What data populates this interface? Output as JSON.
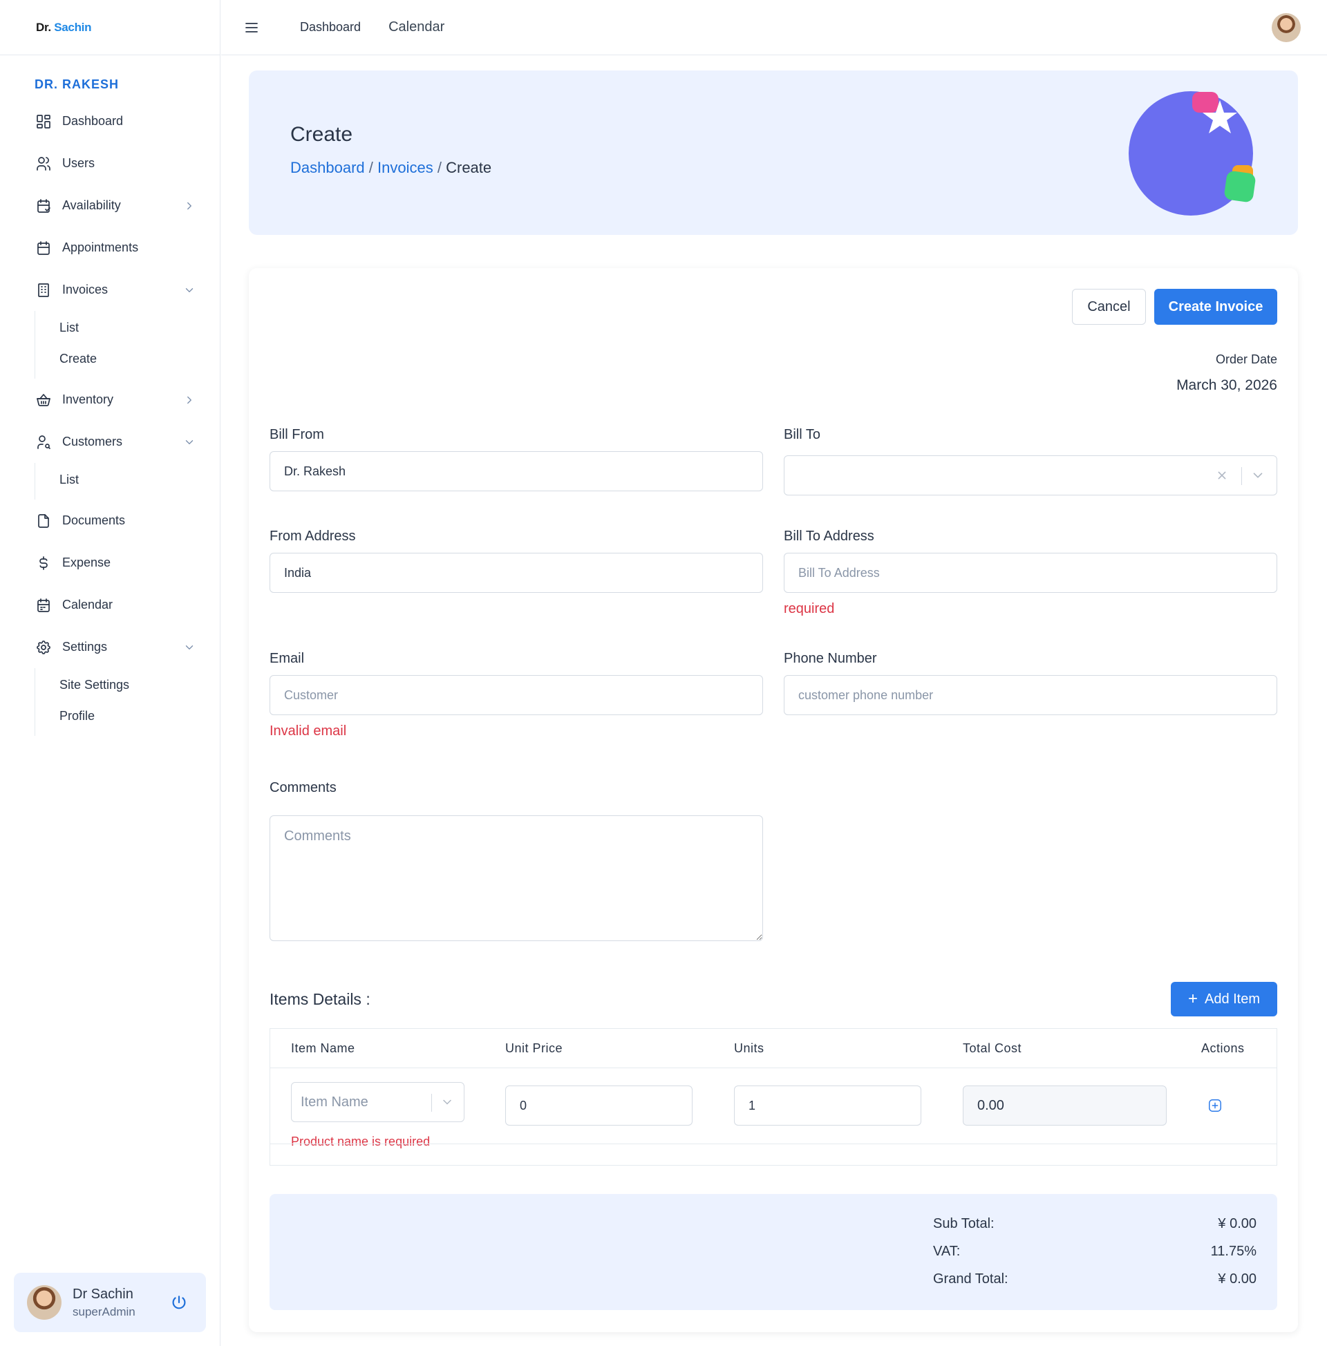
{
  "app": {
    "logo_prefix": "Dr.",
    "logo_accent": "Sachin"
  },
  "sidebar": {
    "heading": "DR. RAKESH",
    "items": [
      {
        "label": "Dashboard",
        "icon": "dashboard-grid-icon"
      },
      {
        "label": "Users",
        "icon": "user-icon"
      },
      {
        "label": "Availability",
        "icon": "calendar-check-icon",
        "expanded": false
      },
      {
        "label": "Appointments",
        "icon": "calendar-icon"
      },
      {
        "label": "Invoices",
        "icon": "building-icon",
        "expanded": true,
        "children": [
          "List",
          "Create"
        ]
      },
      {
        "label": "Inventory",
        "icon": "basket-icon",
        "expanded": false
      },
      {
        "label": "Customers",
        "icon": "user-search-icon",
        "expanded": true,
        "children": [
          "List"
        ]
      },
      {
        "label": "Documents",
        "icon": "file-icon"
      },
      {
        "label": "Expense",
        "icon": "dollar-icon"
      },
      {
        "label": "Calendar",
        "icon": "calendar-event-icon"
      },
      {
        "label": "Settings",
        "icon": "gear-icon",
        "expanded": true,
        "children": [
          "Site Settings",
          "Profile"
        ]
      }
    ],
    "user": {
      "name": "Dr Sachin",
      "role": "superAdmin"
    }
  },
  "topbar": {
    "links": [
      "Dashboard",
      "Calendar"
    ]
  },
  "banner": {
    "title": "Create",
    "breadcrumb": [
      "Dashboard",
      "Invoices",
      "Create"
    ],
    "separator": "/"
  },
  "form": {
    "cancel_label": "Cancel",
    "submit_label": "Create Invoice",
    "order_date_label": "Order Date",
    "order_date": "March 30, 2026",
    "bill_from": {
      "label": "Bill From",
      "value": "Dr. Rakesh"
    },
    "bill_to": {
      "label": "Bill To",
      "value": ""
    },
    "from_address": {
      "label": "From Address",
      "value": "India"
    },
    "bill_to_address": {
      "label": "Bill To Address",
      "placeholder": "Bill To Address",
      "error": "required"
    },
    "email": {
      "label": "Email",
      "placeholder": "Customer",
      "error": "Invalid email"
    },
    "phone": {
      "label": "Phone Number",
      "placeholder": "customer phone number"
    },
    "comments": {
      "label": "Comments",
      "placeholder": "Comments"
    }
  },
  "items": {
    "title": "Items Details :",
    "add_label": "Add Item",
    "columns": [
      "Item Name",
      "Unit Price",
      "Units",
      "Total Cost",
      "Actions"
    ],
    "rows": [
      {
        "item_placeholder": "Item Name",
        "unit_price": "0",
        "units": "1",
        "total_cost": "0.00",
        "error": "Product name is required"
      }
    ]
  },
  "totals": {
    "sub_total_label": "Sub Total:",
    "sub_total": "¥ 0.00",
    "vat_label": "VAT:",
    "vat": "11.75%",
    "grand_total_label": "Grand Total:",
    "grand_total": "¥ 0.00"
  },
  "colors": {
    "accent": "#2c7bea",
    "banner_bg": "#ecf2ff",
    "error": "#dc3545",
    "illustration_circle": "#6a6ef0",
    "illustration_pink": "#ec4b96",
    "illustration_orange": "#f5a623",
    "illustration_green": "#3fd47a"
  }
}
